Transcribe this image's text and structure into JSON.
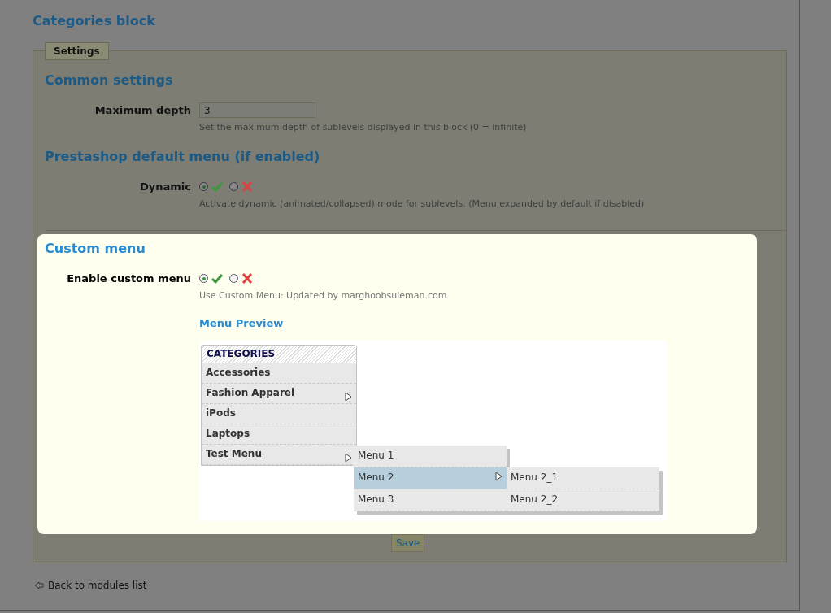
{
  "page": {
    "title": "Categories block"
  },
  "fieldset": {
    "legend": "Settings"
  },
  "sections": [
    {
      "heading": "Common settings",
      "highlighted": false,
      "fields": [
        {
          "kind": "text",
          "label": "Maximum depth",
          "value": "3",
          "help": "Set the maximum depth of sublevels displayed in this block (0 = infinite)"
        }
      ]
    },
    {
      "heading": "Prestashop default menu (if enabled)",
      "highlighted": false,
      "fields": [
        {
          "kind": "radio",
          "label": "Dynamic",
          "options": [
            {
              "kind": "yes",
              "selected": true
            },
            {
              "kind": "no",
              "selected": false
            }
          ],
          "help": "Activate dynamic (animated/collapsed) mode for sublevels. (Menu expanded by default if disabled)"
        }
      ]
    },
    {
      "heading": "Custom menu",
      "highlighted": true,
      "fields": [
        {
          "kind": "radio",
          "label": "Enable custom menu",
          "options": [
            {
              "kind": "yes",
              "selected": true
            },
            {
              "kind": "no",
              "selected": false
            }
          ],
          "help": "Use Custom Menu: Updated by marghoobsuleman.com"
        }
      ],
      "preview": {
        "title": "Menu Preview",
        "header": "CATEGORIES",
        "items": [
          {
            "label": "Accessories",
            "selected": false,
            "submenu": false
          },
          {
            "label": "Fashion Apparel",
            "selected": false,
            "submenu": true
          },
          {
            "label": "iPods",
            "selected": false,
            "submenu": false
          },
          {
            "label": "Laptops",
            "selected": false,
            "submenu": false
          },
          {
            "label": "Test Menu",
            "selected": false,
            "submenu": true,
            "expanded": true,
            "children": [
              {
                "label": "Menu 1",
                "selected": false,
                "submenu": false
              },
              {
                "label": "Menu 2",
                "selected": true,
                "submenu": true,
                "expanded": true,
                "children": [
                  {
                    "label": "Menu 2_1",
                    "selected": false,
                    "submenu": false
                  },
                  {
                    "label": "Menu 2_2",
                    "selected": false,
                    "submenu": false
                  }
                ]
              },
              {
                "label": "Menu 3",
                "selected": false,
                "submenu": false
              }
            ]
          }
        ]
      }
    }
  ],
  "save_button": "Save",
  "back_link": "Back to modules list"
}
